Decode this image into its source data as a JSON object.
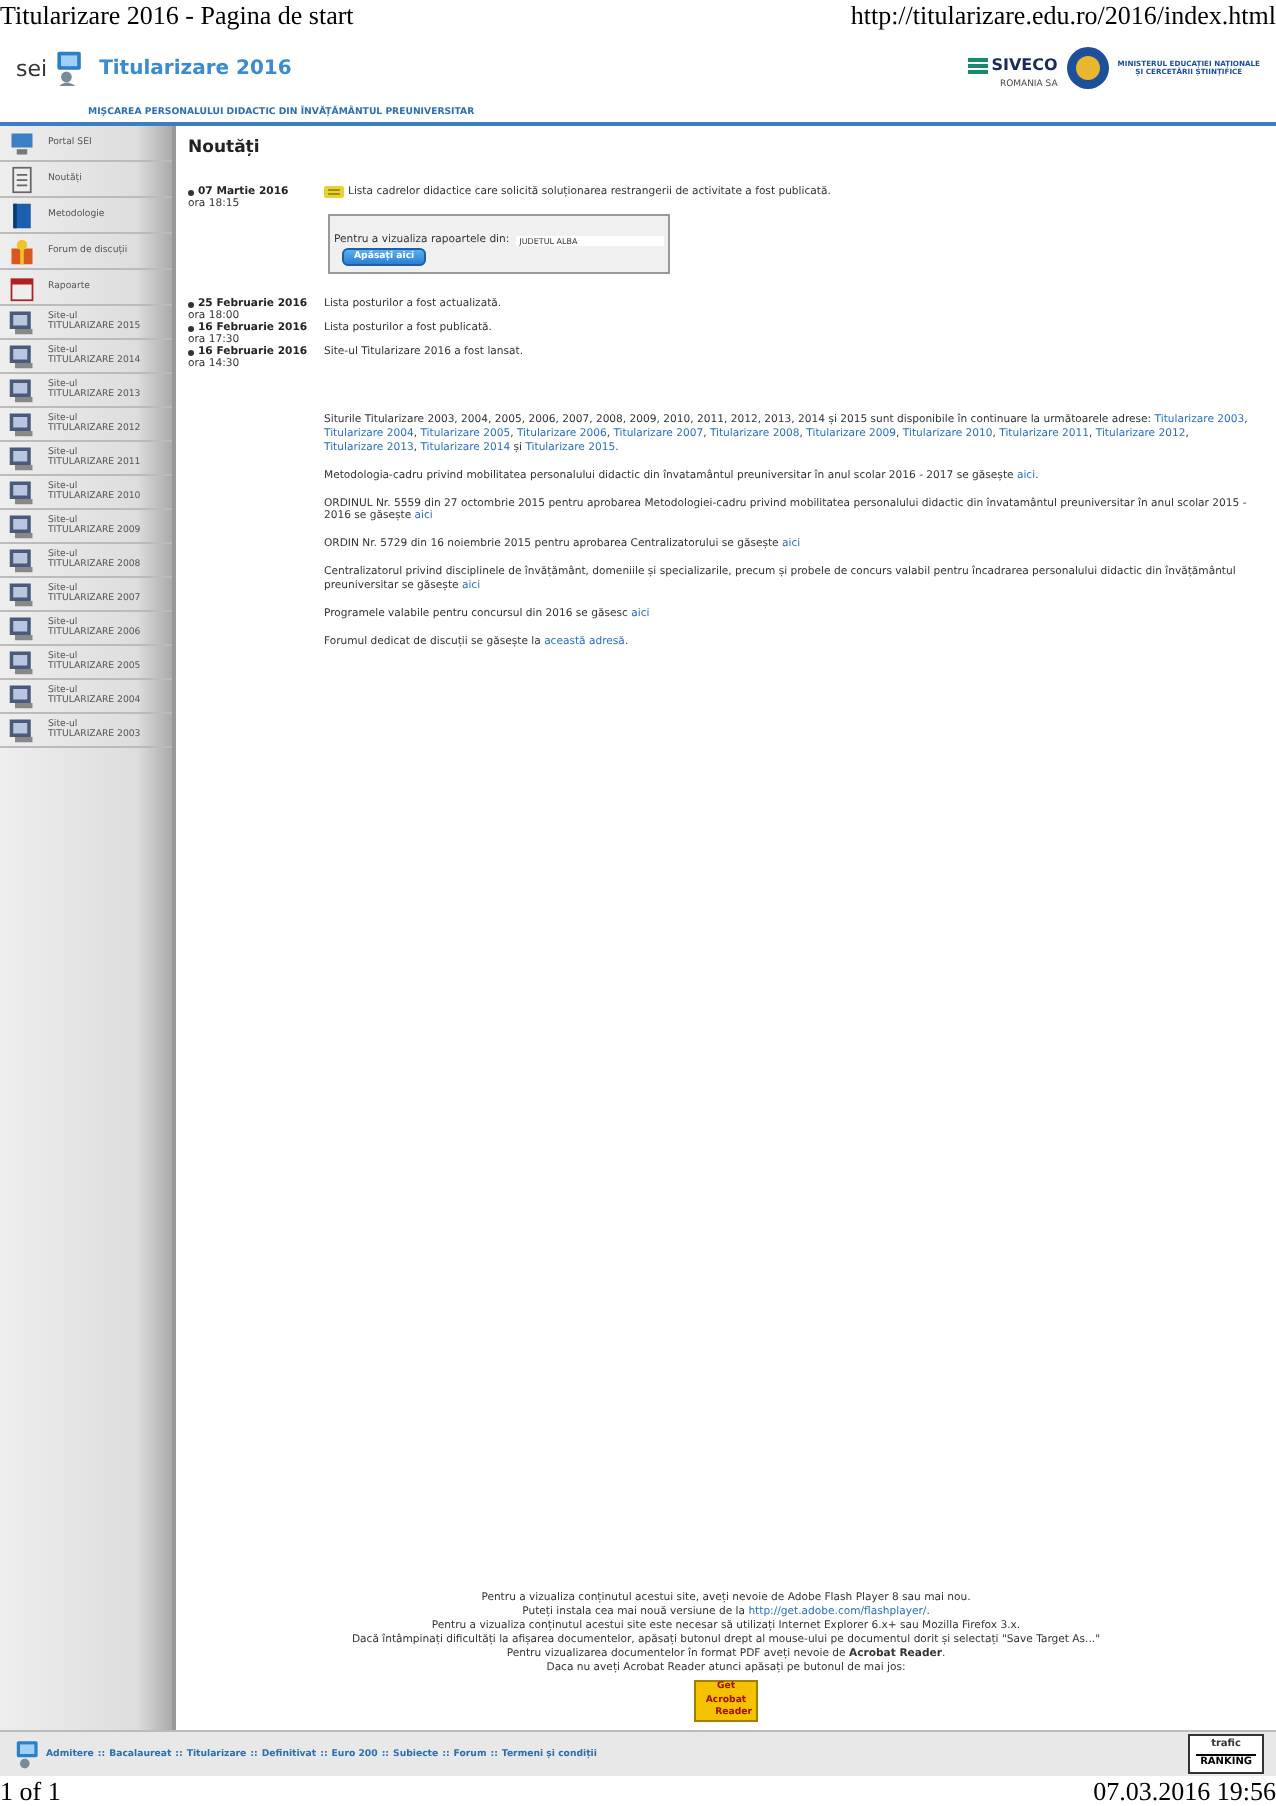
{
  "print_header": {
    "title": "Titularizare 2016 - Pagina de start",
    "url": "http://titularizare.edu.ro/2016/index.html"
  },
  "header": {
    "logo_text": "sei",
    "title": "Titularizare 2016",
    "partner": "SIVECO",
    "partner_sub": "ROMANIA SA",
    "ministry_lines": [
      "MINISTERUL EDUCAȚIEI NAȚIONALE",
      "ȘI CERCETĂRII ȘTIINȚIFICE"
    ],
    "subtitle": "MIȘCAREA PERSONALULUI DIDACTIC DIN ÎNVĂȚĂMÂNTUL PREUNIVERSITAR"
  },
  "sidebar": {
    "items": [
      {
        "kind": "portal",
        "label": "Portal SEI"
      },
      {
        "kind": "news",
        "label": "Noutăți"
      },
      {
        "kind": "book",
        "label": "Metodologie"
      },
      {
        "kind": "forum",
        "label": "Forum de discuții"
      },
      {
        "kind": "reports",
        "label": "Rapoarte"
      },
      {
        "kind": "site",
        "label": "Site-ul",
        "sublabel": "TITULARIZARE 2015"
      },
      {
        "kind": "site",
        "label": "Site-ul",
        "sublabel": "TITULARIZARE 2014"
      },
      {
        "kind": "site",
        "label": "Site-ul",
        "sublabel": "TITULARIZARE 2013"
      },
      {
        "kind": "site",
        "label": "Site-ul",
        "sublabel": "TITULARIZARE 2012"
      },
      {
        "kind": "site",
        "label": "Site-ul",
        "sublabel": "TITULARIZARE 2011"
      },
      {
        "kind": "site",
        "label": "Site-ul",
        "sublabel": "TITULARIZARE 2010"
      },
      {
        "kind": "site",
        "label": "Site-ul",
        "sublabel": "TITULARIZARE 2009"
      },
      {
        "kind": "site",
        "label": "Site-ul",
        "sublabel": "TITULARIZARE 2008"
      },
      {
        "kind": "site",
        "label": "Site-ul",
        "sublabel": "TITULARIZARE 2007"
      },
      {
        "kind": "site",
        "label": "Site-ul",
        "sublabel": "TITULARIZARE 2006"
      },
      {
        "kind": "site",
        "label": "Site-ul",
        "sublabel": "TITULARIZARE 2005"
      },
      {
        "kind": "site",
        "label": "Site-ul",
        "sublabel": "TITULARIZARE 2004"
      },
      {
        "kind": "site",
        "label": "Site-ul",
        "sublabel": "TITULARIZARE 2003"
      }
    ]
  },
  "news": {
    "heading": "Noutăți",
    "items": [
      {
        "date": "07 Martie 2016",
        "time": "ora 18:15",
        "is_new": true,
        "text": "Lista cadrelor didactice care solicită soluționarea restrangerii de activitate a fost publicată.",
        "report": {
          "label": "Pentru a vizualiza rapoartele din:",
          "county": "JUDETUL ALBA",
          "button": "Apăsați aici"
        }
      },
      {
        "date": "25 Februarie 2016",
        "time": "ora 18:00",
        "is_new": false,
        "text": "Lista posturilor a fost actualizată."
      },
      {
        "date": "16 Februarie 2016",
        "time": "ora 17:30",
        "is_new": false,
        "text": "Lista posturilor a fost publicată."
      },
      {
        "date": "16 Februarie 2016",
        "time": "ora 14:30",
        "is_new": false,
        "text": "Site-ul Titularizare 2016 a fost lansat."
      }
    ]
  },
  "paragraphs": [
    [
      {
        "text": "Siturile Titularizare 2003, 2004, 2005, 2006, 2007, 2008, 2009, 2010, 2011, 2012, 2013, 2014 și 2015 sunt disponibile în continuare la următoarele adrese: "
      },
      {
        "text": "Titularizare 2003",
        "link": true
      },
      {
        "text": ", "
      },
      {
        "text": "Titularizare 2004",
        "link": true
      },
      {
        "text": ", "
      },
      {
        "text": "Titularizare 2005",
        "link": true
      },
      {
        "text": ", "
      },
      {
        "text": "Titularizare 2006",
        "link": true
      },
      {
        "text": ", "
      },
      {
        "text": "Titularizare 2007",
        "link": true
      },
      {
        "text": ", "
      },
      {
        "text": "Titularizare 2008",
        "link": true
      },
      {
        "text": ", "
      },
      {
        "text": "Titularizare 2009",
        "link": true
      },
      {
        "text": ", "
      },
      {
        "text": "Titularizare 2010",
        "link": true
      },
      {
        "text": ", "
      },
      {
        "text": "Titularizare 2011",
        "link": true
      },
      {
        "text": ", "
      },
      {
        "text": "Titularizare 2012",
        "link": true
      },
      {
        "text": ", "
      },
      {
        "text": "Titularizare 2013",
        "link": true
      },
      {
        "text": ", "
      },
      {
        "text": "Titularizare 2014",
        "link": true
      },
      {
        "text": " și "
      },
      {
        "text": "Titularizare 2015",
        "link": true
      },
      {
        "text": "."
      }
    ],
    [
      {
        "text": "Metodologia-cadru privind mobilitatea personalului didactic din învatamântul preuniversitar în anul scolar 2016 - 2017 se găsește "
      },
      {
        "text": "aici",
        "link": true
      },
      {
        "text": "."
      }
    ],
    [
      {
        "text": "ORDINUL Nr. 5559 din 27 octombrie 2015 pentru aprobarea Metodologiei-cadru privind mobilitatea personalului didactic din învatamântul preuniversitar în anul scolar 2015 - 2016 se găsește "
      },
      {
        "text": "aici",
        "link": true
      }
    ],
    [
      {
        "text": "ORDIN Nr. 5729 din 16 noiembrie 2015 pentru aprobarea Centralizatorului se găsește "
      },
      {
        "text": "aici",
        "link": true
      }
    ],
    [
      {
        "text": "Centralizatorul privind disciplinele de învățământ, domeniile și specializarile, precum și probele de concurs valabil pentru încadrarea personalului didactic din învățământul preuniversitar se găsește "
      },
      {
        "text": "aici",
        "link": true
      }
    ],
    [
      {
        "text": "Programele valabile pentru concursul din 2016 se găsesc "
      },
      {
        "text": "aici",
        "link": true
      }
    ],
    [
      {
        "text": "Forumul dedicat de discuții se găsește la "
      },
      {
        "text": "această adresă",
        "link": true
      },
      {
        "text": "."
      }
    ]
  ],
  "requirements": [
    [
      {
        "text": "Pentru a vizualiza conținutul acestui site, aveți nevoie de Adobe Flash Player 8 sau mai nou."
      }
    ],
    [
      {
        "text": "Puteți instala cea mai nouă versiune de la "
      },
      {
        "text": "http://get.adobe.com/flashplayer/",
        "link": true
      },
      {
        "text": "."
      }
    ],
    [
      {
        "text": "Pentru a vizualiza conținutul acestui site este necesar să utilizați Internet Explorer 6.x+ sau Mozilla Firefox 3.x."
      }
    ],
    [
      {
        "text": "Dacă întâmpinați dificultăți la afișarea documentelor, apăsați butonul drept al mouse-ului pe documentul dorit și selectați \"Save Target As...\""
      }
    ],
    [
      {
        "text": "Pentru vizualizarea documentelor în format PDF aveți nevoie de **Acrobat Reader**."
      }
    ],
    [
      {
        "text": "Daca nu aveți Acrobat Reader atunci apăsați pe butonul de mai jos:"
      }
    ]
  ],
  "acrobat_button": {
    "line1": "Get Acrobat",
    "line2": "Reader"
  },
  "footer": {
    "separator": "::",
    "links": [
      "Admitere",
      "Bacalaureat",
      "Titularizare",
      "Definitivat",
      "Euro 200",
      "Subiecte",
      "Forum",
      "Termeni și condiții"
    ],
    "badge_top": "trafic",
    "badge_bottom": "RANKING"
  },
  "print_footer": {
    "pages": "1 of 1",
    "timestamp": "07.03.2016 19:56"
  }
}
